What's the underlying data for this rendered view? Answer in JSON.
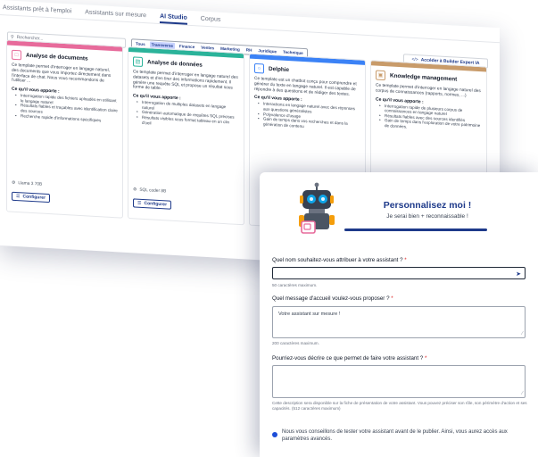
{
  "topnav": {
    "tabs": [
      "Assistants prêt à l'emploi",
      "Assistants sur mesure",
      "AI Studio",
      "Corpus"
    ],
    "active": "AI Studio"
  },
  "search": {
    "placeholder": "Rechercher..."
  },
  "filters": [
    "Tous",
    "Transverse",
    "Finance",
    "Ventes",
    "Marketing",
    "RH",
    "Juridique",
    "Technique"
  ],
  "active_filter": "Transverse",
  "builder_button": "Accéder à Builder Expert IA",
  "cards": [
    {
      "title": "Analyse de documents",
      "icon": "document-search-icon",
      "color": "#e76b9b",
      "description": "Ce template permet d'interroger en langage naturel, des documents que vous importez directement dans l'interface de chat. Nous vous recommandons de l'utiliser ...",
      "benefits_title": "Ce qu'il vous apporte :",
      "benefits": [
        "Interrogation rapide des fichiers uploadés en utilisant le langage naturel",
        "Résultats fiables et traçables avec identification claire des sources",
        "Recherche rapide d'informations spécifiques"
      ],
      "model": "Llama 3 70B",
      "configure": "Configurer"
    },
    {
      "title": "Analyse de données",
      "icon": "data-table-icon",
      "color": "#2bb39a",
      "description": "Ce template permet d'interroger en langage naturel des datasets et d'en tirer des informations rapidement. Il génère une requête SQL et propose un résultat sous forme de table.",
      "benefits_title": "Ce qu'il vous apporte :",
      "benefits": [
        "Interrogation de multiples datasets en langage naturel",
        "Génération automatique de requêtes SQL précises",
        "Résultats visibles sous format tableau en un clin d'oeil"
      ],
      "model": "SQL coder 8B",
      "configure": "Configurer"
    },
    {
      "title": "Delphie",
      "icon": "chat-bubble-icon",
      "color": "#3b82f6",
      "description": "Ce template est un chatbot conçu pour comprendre et générer du texte en langage naturel. Il est capable de répondre à des questions et de rédiger des textes.",
      "benefits_title": "Ce qu'il vous apporte :",
      "benefits": [
        "Interactions en langage naturel avec des réponses aux questions généralistes",
        "Polyvalence d'usage",
        "Gain de temps dans vos recherches et dans la génération de contenu"
      ],
      "model": "",
      "configure": ""
    },
    {
      "title": "Knowledge management",
      "icon": "book-icon",
      "color": "#c89b6a",
      "description": "Ce template permet d'interroger en langage naturel des corpus de connaissances (rapports, normes, ...)",
      "benefits_title": "Ce qu'il vous apporte :",
      "benefits": [
        "Interrogation rapide de plusieurs corpus de connaissances en langage naturel",
        "Résultats fiables avec des sources identifiés",
        "Gain de temps dans l'exploration de votre patrimoine de données."
      ],
      "model": "",
      "configure": ""
    }
  ],
  "dialog": {
    "title": "Personnalisez moi !",
    "subtitle": "Je serai bien + reconnaissable !",
    "name_question": "Quel nom souhaitez-vous attribuer à votre assistant ?",
    "name_value": "",
    "name_hint": "50 caractères maximum.",
    "welcome_question": "Quel message d'accueil voulez-vous proposer ?",
    "welcome_value": "Votre assistant sur mesure !",
    "welcome_hint": "200 caractères maximum.",
    "describe_question": "Pourriez-vous décrire ce que permet de faire votre assistant ?",
    "describe_value": "",
    "describe_hint": "Cette description sera disponible sur la fiche de présentation de votre assistant. Vous pouvez préciser son rôle, son périmètre d'action et ses capacités. (512 caractères maximum)",
    "required_mark": "*",
    "tip": "Nous vous conseillons de tester votre assistant avant de le publier. Ainsi, vous aurez accès aux paramètres avancés."
  }
}
